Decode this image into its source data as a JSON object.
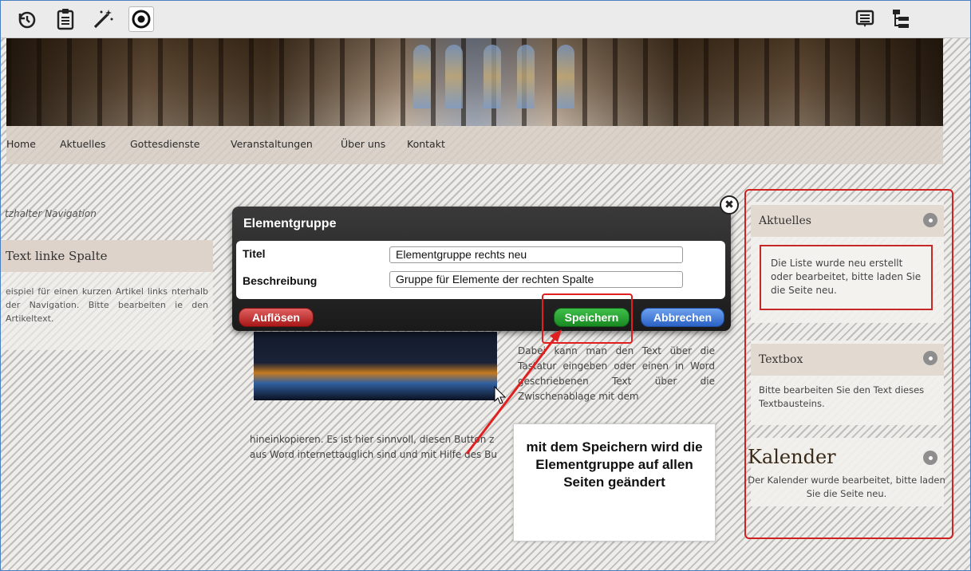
{
  "toolbar": {
    "left_icons": [
      "history-icon",
      "clipboard-icon",
      "magic-wand-icon",
      "target-icon"
    ],
    "right_icons": [
      "list-view-icon",
      "tree-view-icon"
    ]
  },
  "nav": {
    "items": [
      "Home",
      "Aktuelles",
      "Gottesdienste",
      "Veranstaltungen",
      "Über uns",
      "Kontakt"
    ]
  },
  "left": {
    "nav_placeholder": "tzhalter Navigation",
    "box_title": "Text linke Spalte",
    "box_text": "eispiel für einen kurzen Artikel links nterhalb der Navigation. Bitte bearbeiten ie den Artikeltext."
  },
  "main": {
    "text_right": "Dabei kann man den Text über die Tastatur eingeben oder einen in Word geschriebenen Text über die Zwischenablage mit dem",
    "text_bottom_1": "hineinkopieren. Es ist hier sinnvoll, diesen Button z",
    "text_bottom_2": "aus Word internettauglich sind und mit Hilfe des Bu"
  },
  "dialog": {
    "title": "Elementgruppe",
    "fields": [
      {
        "label": "Titel",
        "value": "Elementgruppe rechts neu"
      },
      {
        "label": "Beschreibung",
        "value": "Gruppe für Elemente der rechten Spalte"
      }
    ],
    "dissolve_label": "Auflösen",
    "save_label": "Speichern",
    "cancel_label": "Abbrechen",
    "close_symbol": "✖"
  },
  "right": {
    "aktuelles_title": "Aktuelles",
    "aktuelles_msg": "Die Liste wurde neu erstellt oder bearbeitet, bitte laden Sie die Seite neu.",
    "textbox_title": "Textbox",
    "textbox_msg": "Bitte bearbeiten Sie den Text dieses Textbausteins.",
    "kalender_title": "Kalender",
    "kalender_msg": "Der Kalender wurde bearbeitet, bitte laden Sie die Seite neu."
  },
  "callout": {
    "text": "mit dem Speichern wird die Elementgruppe auf allen Seiten geändert"
  },
  "colors": {
    "highlight_red": "#d02020",
    "save_green": "#198a22",
    "cancel_blue": "#2a62c6",
    "dissolve_red": "#a81818"
  }
}
